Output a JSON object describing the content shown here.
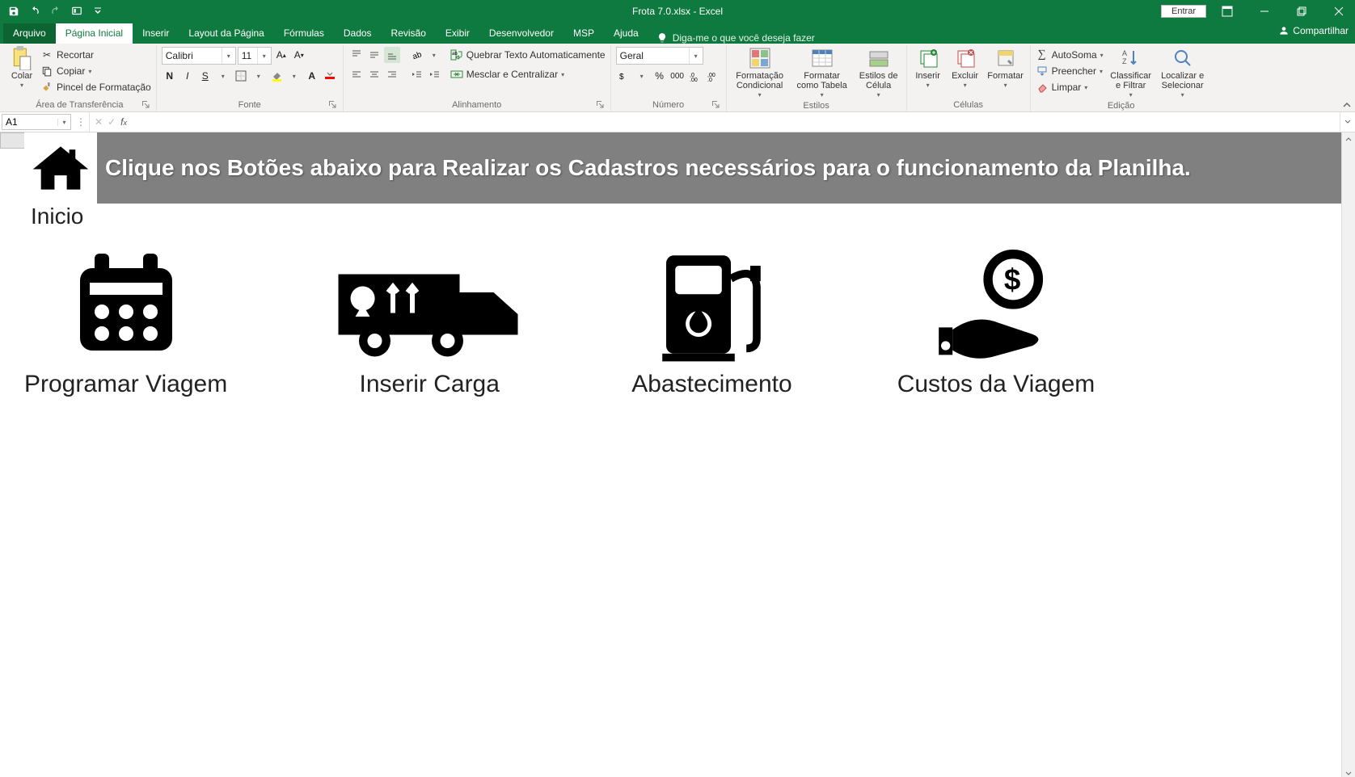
{
  "title": "Frota 7.0.xlsx  -  Excel",
  "signin": "Entrar",
  "tabs": {
    "file": "Arquivo",
    "home": "Página Inicial",
    "insert": "Inserir",
    "pagelayout": "Layout da Página",
    "formulas": "Fórmulas",
    "data": "Dados",
    "review": "Revisão",
    "view": "Exibir",
    "developer": "Desenvolvedor",
    "msp": "MSP",
    "help": "Ajuda",
    "tellme": "Diga-me o que você deseja fazer",
    "share": "Compartilhar"
  },
  "ribbon": {
    "clipboard": {
      "title": "Área de Transferência",
      "paste": "Colar",
      "cut": "Recortar",
      "copy": "Copiar",
      "painter": "Pincel de Formatação"
    },
    "font": {
      "title": "Fonte",
      "name": "Calibri",
      "size": "11"
    },
    "alignment": {
      "title": "Alinhamento",
      "wrap": "Quebrar Texto Automaticamente",
      "merge": "Mesclar e Centralizar"
    },
    "number": {
      "title": "Número",
      "format": "Geral"
    },
    "styles": {
      "title": "Estilos",
      "condfmt": "Formatação Condicional",
      "fmtTable": "Formatar como Tabela",
      "cellStyles": "Estilos de Célula"
    },
    "cells": {
      "title": "Células",
      "insert": "Inserir",
      "delete": "Excluir",
      "format": "Formatar"
    },
    "editing": {
      "title": "Edição",
      "autosum": "AutoSoma",
      "fill": "Preencher",
      "clear": "Limpar",
      "sort": "Classificar e Filtrar",
      "find": "Localizar e Selecionar"
    }
  },
  "namebox": "A1",
  "sheet": {
    "inicio": "Inicio",
    "banner": "Clique nos Botões abaixo para Realizar os Cadastros necessários para o funcionamento da Planilha.",
    "cards": {
      "programar": "Programar Viagem",
      "inserir": "Inserir Carga",
      "abast": "Abastecimento",
      "custos": "Custos da Viagem"
    }
  }
}
